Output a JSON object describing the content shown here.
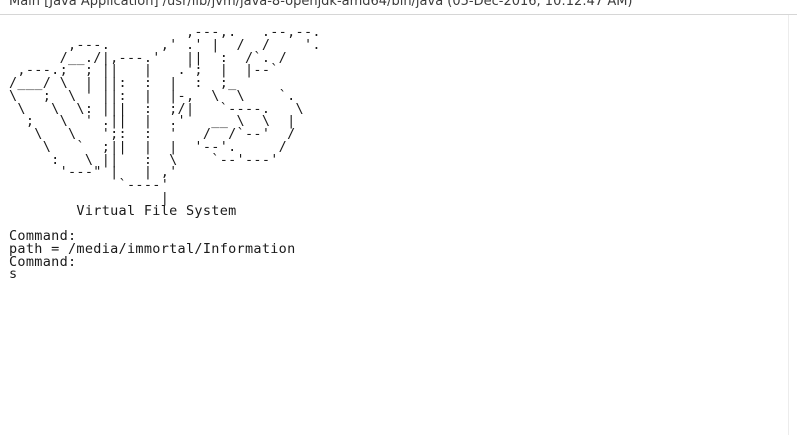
{
  "window": {
    "title": "Main [Java Application] /usr/lib/jvm/java-8-openjdk-amd64/bin/java (05-Dec-2016, 10:12:47 AM)"
  },
  "console": {
    "lines": [
      "                     ,---,.   .--,--.",
      "       ,---.      ,' .' |  /  /    '.",
      "      /__./|,---.'   ||  :  /`. /",
      " ,---.;  ; ||   |   .';  |  |--`",
      "/___/ \\  | ||:  :  |  :  ;_",
      "\\   ;  \\ ' ||:  |  |-,  \\  \\    `.",
      " \\   \\  \\: |||  :  ;/|   `----.   \\",
      "  ;   \\  ' .||  |  .'   __ \\  \\  |",
      "   \\   \\   ';:  :  '   /  /`--'  /",
      "    \\   `  ;||  |  |  '--'.     /",
      "     :   \\ ||   :  \\    `--'---'",
      "      '---\" |   | ,'",
      "             `----'",
      "                  |",
      "        Virtual File System",
      "",
      "Command:",
      "path = /media/immortal/Information",
      "Command:",
      "s"
    ]
  }
}
